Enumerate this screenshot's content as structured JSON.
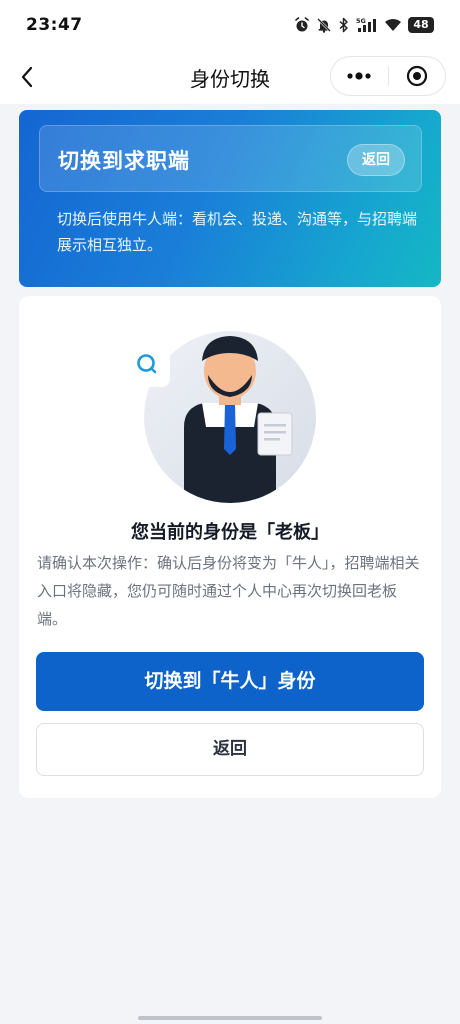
{
  "status_bar": {
    "time": "23:47",
    "network": "5G",
    "battery": "48",
    "icons": [
      "alarm-icon",
      "bell-off-icon",
      "bluetooth-icon",
      "signal-5g-icon",
      "wifi-icon",
      "battery-icon"
    ]
  },
  "nav": {
    "title": "身份切换",
    "back_icon": "chevron-left-icon",
    "more_icon": "more-dots-icon",
    "close_icon": "target-circle-icon"
  },
  "hero": {
    "title": "切换到求职端",
    "back_label": "返回",
    "description": "切换后使用牛人端：看机会、投递、沟通等，与招聘端展示相互独立。"
  },
  "card": {
    "illustration": "boss-avatar-illustration",
    "title": "您当前的身份是「老板」",
    "description": "请确认本次操作：确认后身份将变为「牛人」，招聘端相关入口将隐藏，您仍可随时通过个人中心再次切换回老板端。",
    "primary_button": "切换到「牛人」身份",
    "secondary_button": "返回"
  },
  "colors": {
    "primary": "#0d63c9",
    "hero_start": "#1466d2",
    "hero_end": "#14b8c4",
    "page_bg": "#f2f4f8"
  }
}
